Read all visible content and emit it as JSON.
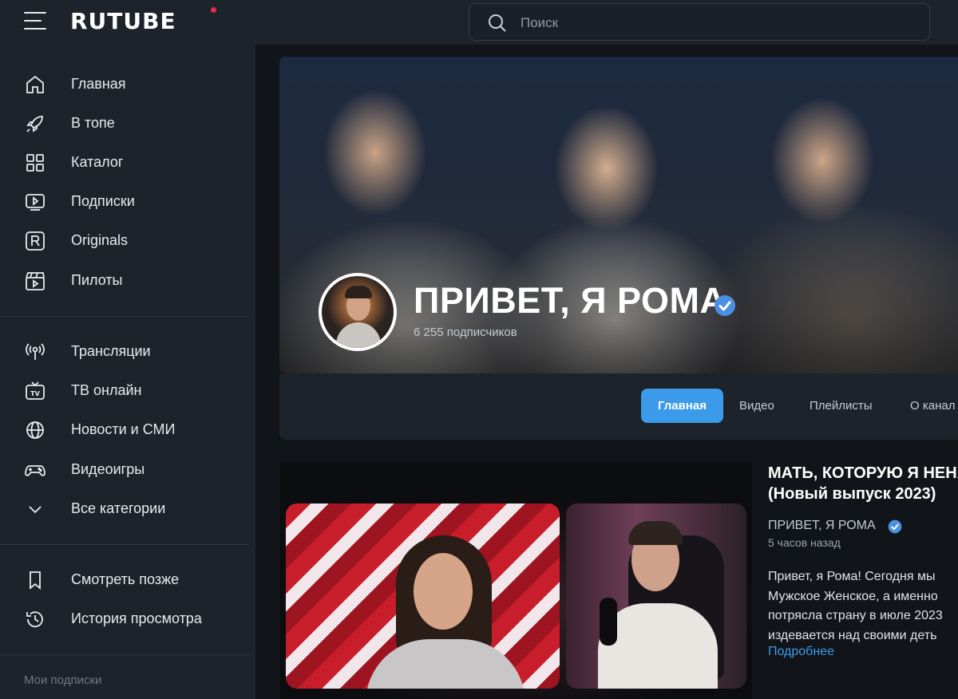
{
  "app": {
    "logo": "RUTUBE",
    "accent": "#3b9bea",
    "brand_dot": "#ee2a47"
  },
  "search": {
    "placeholder": "Поиск",
    "value": ""
  },
  "sidebar": {
    "primary": [
      {
        "label": "Главная",
        "icon": "home-icon"
      },
      {
        "label": "В топе",
        "icon": "rocket-icon"
      },
      {
        "label": "Каталог",
        "icon": "grid-icon"
      },
      {
        "label": "Подписки",
        "icon": "subscriptions-icon"
      },
      {
        "label": "Originals",
        "icon": "originals-icon"
      },
      {
        "label": "Пилоты",
        "icon": "clapperboard-icon"
      }
    ],
    "categories": [
      {
        "label": "Трансляции",
        "icon": "broadcast-icon"
      },
      {
        "label": "ТВ онлайн",
        "icon": "tv-icon"
      },
      {
        "label": "Новости и СМИ",
        "icon": "globe-icon"
      },
      {
        "label": "Видеоигры",
        "icon": "gamepad-icon"
      },
      {
        "label": "Все категории",
        "icon": "chevron-down-icon"
      }
    ],
    "personal": [
      {
        "label": "Смотреть позже",
        "icon": "bookmark-icon"
      },
      {
        "label": "История просмотра",
        "icon": "history-icon"
      }
    ],
    "subscriptions_heading": "Мои подписки"
  },
  "channel": {
    "title": "ПРИВЕТ, Я РОМА",
    "subscribers": "6 255 подписчиков",
    "verified": true
  },
  "tabs": [
    {
      "label": "Главная",
      "active": true
    },
    {
      "label": "Видео",
      "active": false
    },
    {
      "label": "Плейлисты",
      "active": false
    },
    {
      "label": "О канал",
      "active": false
    }
  ],
  "featured": {
    "title_line1": "МАТЬ, КОТОРУЮ Я НЕНА",
    "title_line2": "(Новый выпуск 2023)",
    "channel": "ПРИВЕТ, Я РОМА",
    "time": "5 часов назад",
    "desc_lines": [
      "Привет, я Рома! Сегодня мы",
      "Мужское Женское, а именно",
      "потрясла страну в июле 2023",
      "издевается над своими деть"
    ],
    "more": "Подробнее"
  }
}
